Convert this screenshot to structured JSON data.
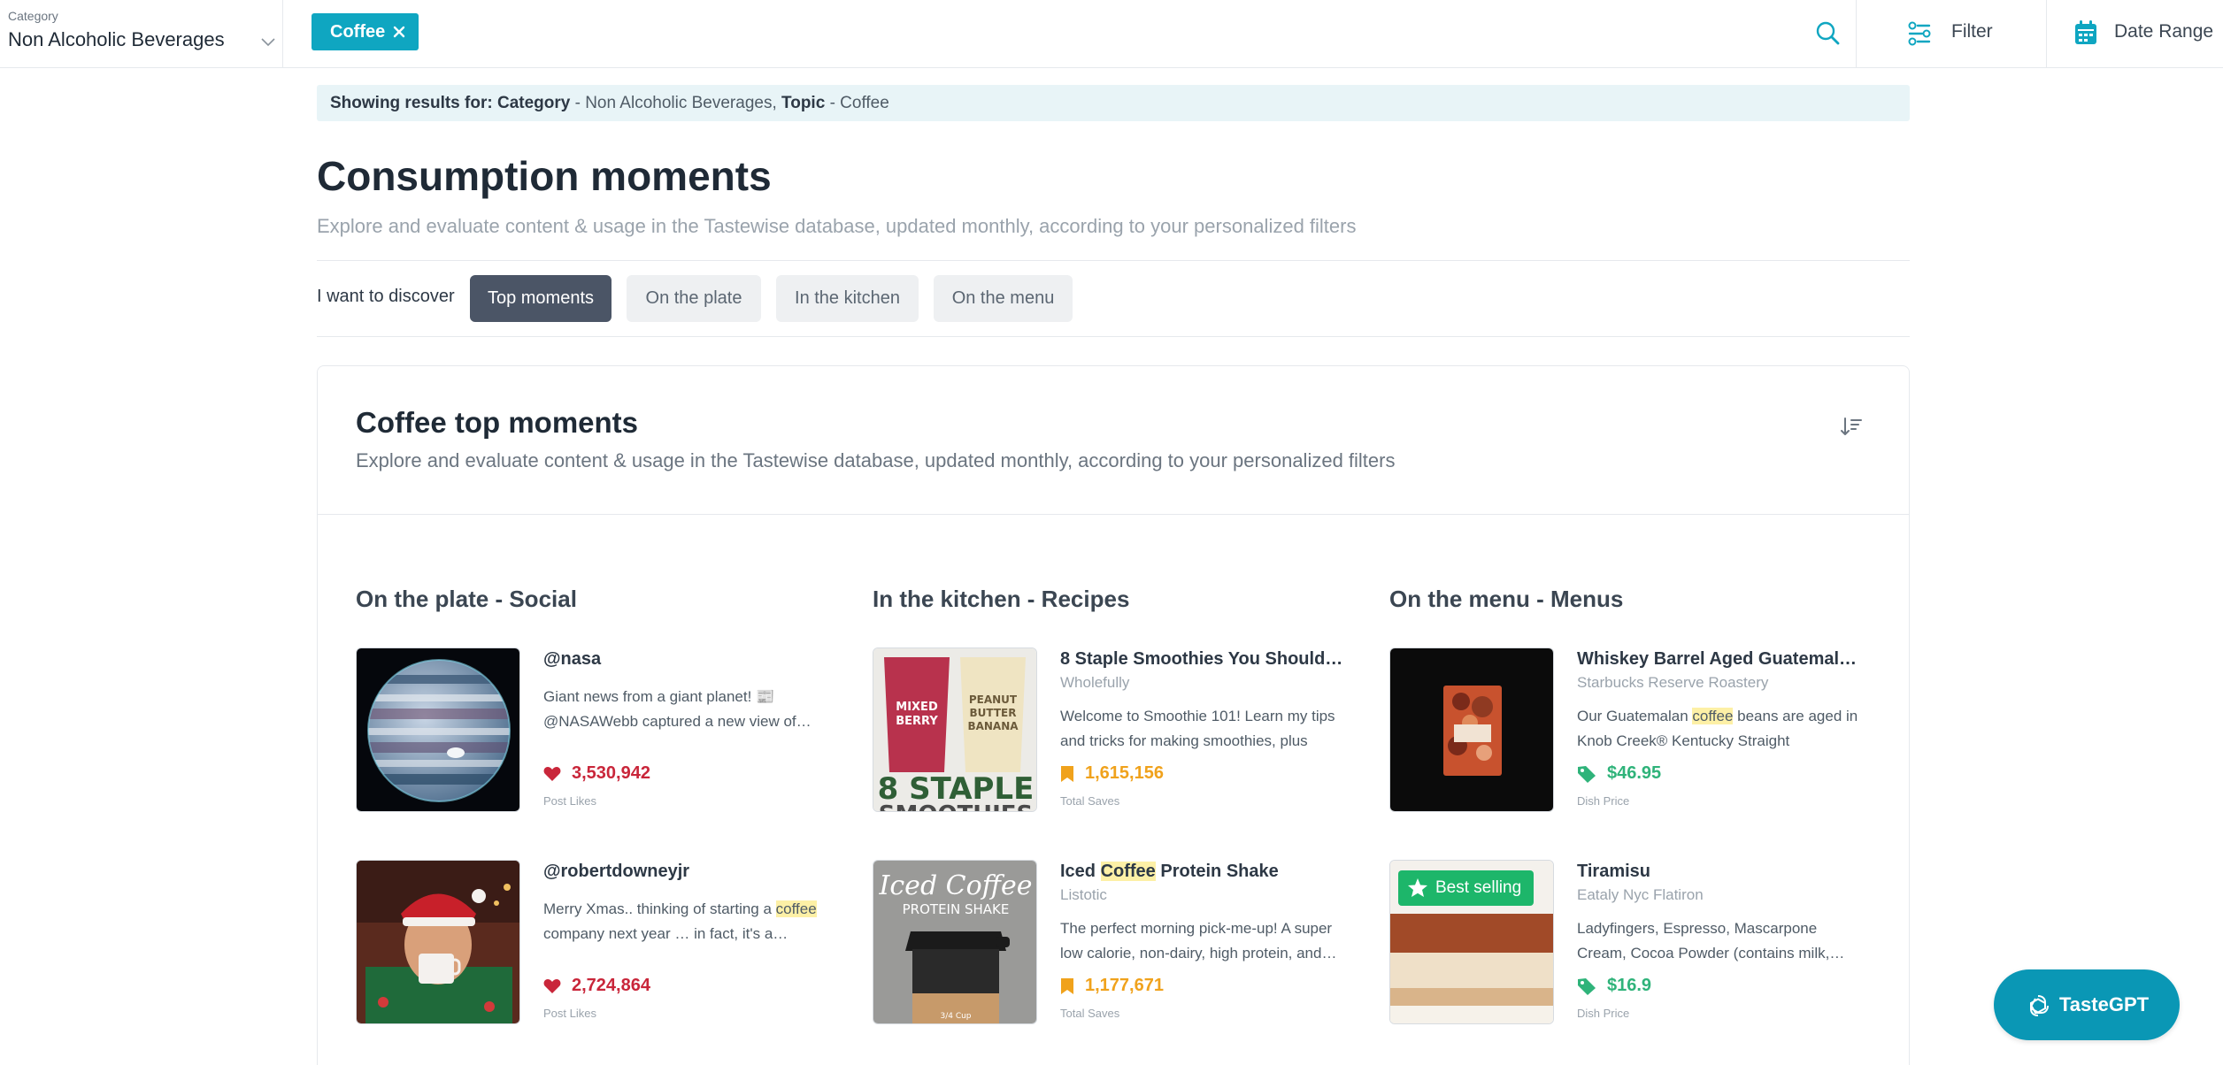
{
  "topbar": {
    "category_label": "Category",
    "category_value": "Non Alcoholic Beverages",
    "topic_chip": "Coffee",
    "filter_label": "Filter",
    "date_label": "Date Range"
  },
  "banner": {
    "prefix": "Showing results for:",
    "cat_key": "Category",
    "cat_value": "- Non Alcoholic Beverages,",
    "topic_key": "Topic",
    "topic_value": "- Coffee"
  },
  "page": {
    "title": "Consumption moments",
    "subtitle": "Explore and evaluate content & usage in the Tastewise database, updated monthly, according to your personalized filters",
    "discover_label": "I want to discover",
    "tabs": [
      "Top moments",
      "On the plate",
      "In the kitchen",
      "On the menu"
    ]
  },
  "card": {
    "title": "Coffee top moments",
    "subtitle": "Explore and evaluate content & usage in the Tastewise database, updated monthly, according to your personalized filters",
    "columns": [
      "On the plate - Social",
      "In the kitchen - Recipes",
      "On the menu - Menus"
    ]
  },
  "social": [
    {
      "title": "@nasa",
      "desc": "Giant news from a giant planet! 📰 @NASAWebb captured a new view of…",
      "metric": "3,530,942",
      "metric_label": "Post Likes"
    },
    {
      "title": "@robertdowneyjr",
      "desc_pre": "Merry Xmas.. thinking of starting a ",
      "desc_hl": "coffee",
      "desc_post": " company next year … in fact, it's a…",
      "metric": "2,724,864",
      "metric_label": "Post Likes"
    }
  ],
  "recipes": [
    {
      "title": "8 Staple Smoothies You Should K…",
      "source": "Wholefully",
      "desc": "Welcome to Smoothie 101! Learn my tips and tricks for making smoothies, plus get…",
      "metric": "1,615,156",
      "metric_label": "Total Saves",
      "img_text_1": "MIXED",
      "img_text_2": "BERRY",
      "img_text_3": "PEANUT",
      "img_text_4": "BUTTER",
      "img_text_5": "BANANA",
      "img_text_6": "8 STAPLE",
      "img_text_7": "SMOOTHIES"
    },
    {
      "title_pre": "Iced ",
      "title_hl": "Coffee",
      "title_post": " Protein Shake",
      "source": "Listotic",
      "desc": "The perfect morning pick-me-up! A super low calorie, non-dairy, high protein, and…",
      "metric": "1,177,671",
      "metric_label": "Total Saves",
      "img_text_1": "Iced Coffee",
      "img_text_2": "PROTEIN SHAKE",
      "img_text_3": "3/4 Cup"
    }
  ],
  "menus": [
    {
      "title": "Whiskey Barrel Aged Guatemala …",
      "source": "Starbucks Reserve Roastery",
      "desc_pre": "Our Guatemalan ",
      "desc_hl": "coffee",
      "desc_post": " beans are aged in Knob Creek® Kentucky Straight Bourbon…",
      "metric": "$46.95",
      "metric_label": "Dish Price"
    },
    {
      "title": "Tiramisu",
      "source": "Eataly Nyc Flatiron",
      "desc": "Ladyfingers, Espresso, Mascarpone Cream, Cocoa Powder (contains milk,…",
      "metric": "$16.9",
      "metric_label": "Dish Price",
      "badge": "Best selling"
    }
  ],
  "tastegpt_label": "TasteGPT",
  "colors": {
    "accent": "#0fa6c1",
    "likes": "#c9263a",
    "saves": "#f0a21c",
    "price": "#2fb37a",
    "tab_active": "#4b5566"
  }
}
